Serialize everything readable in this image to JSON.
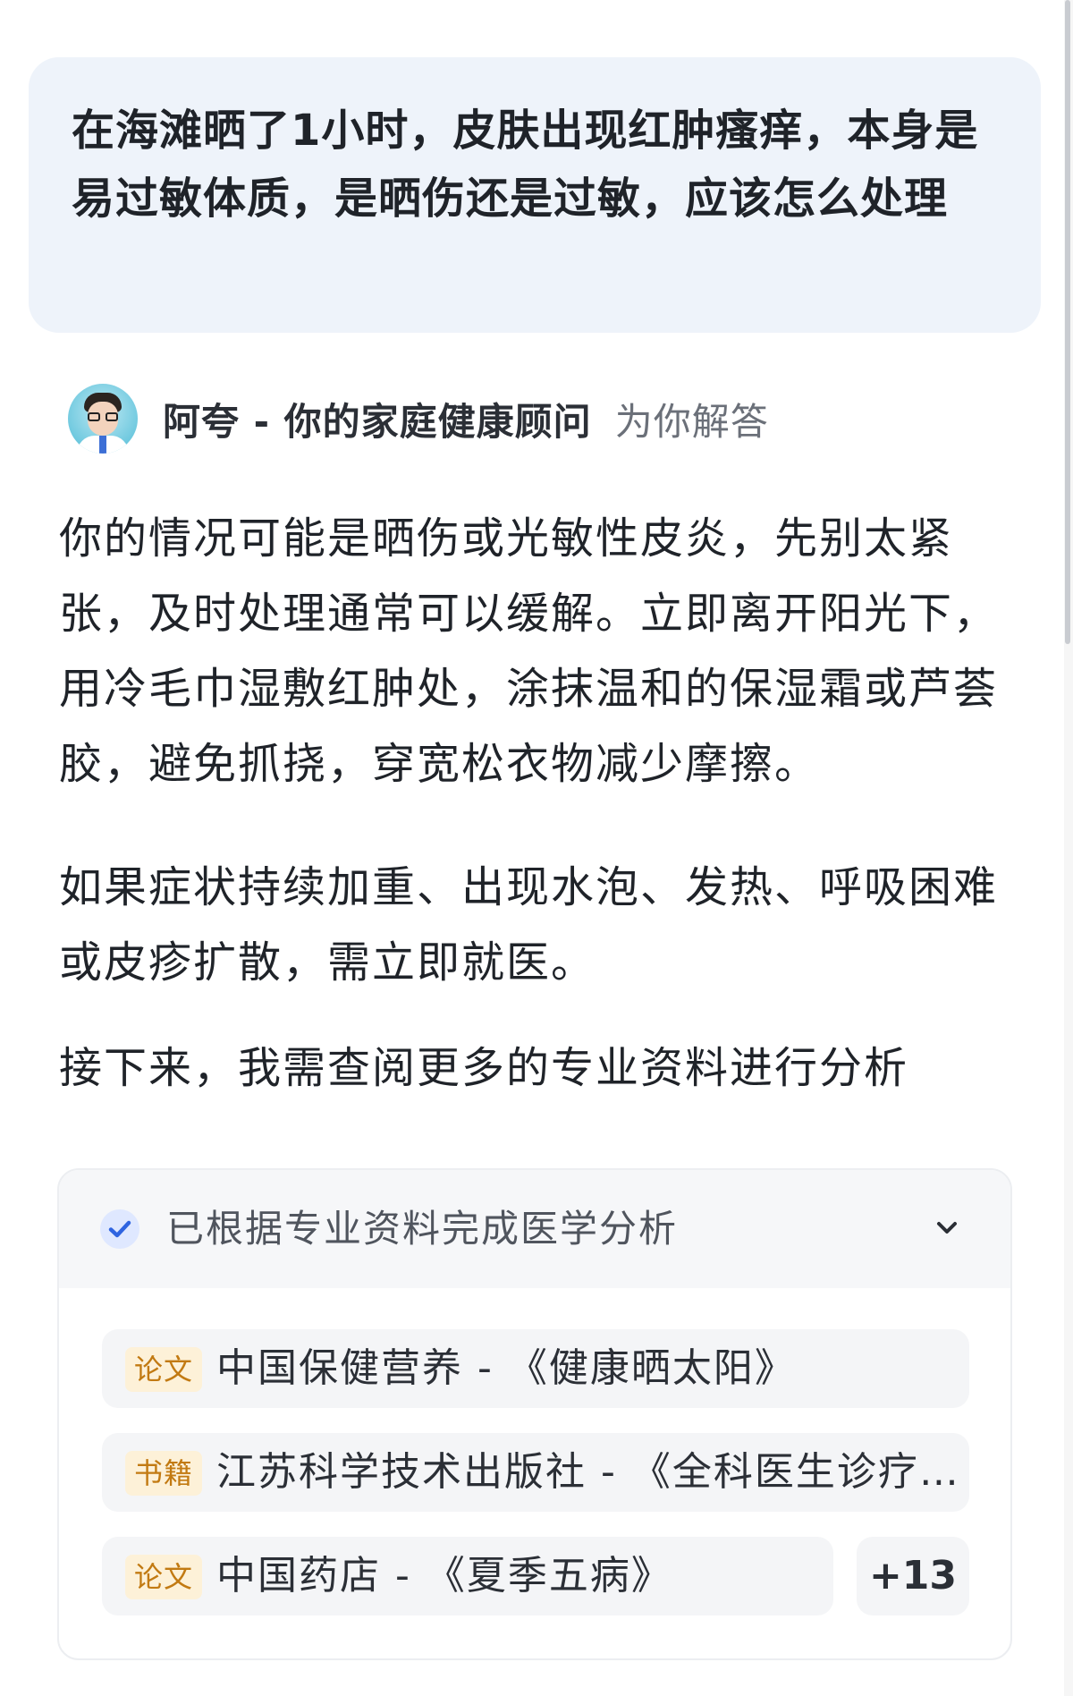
{
  "question": {
    "text": "在海滩晒了1小时，皮肤出现红肿瘙痒，本身是易过敏体质，是晒伤还是过敏，应该怎么处理"
  },
  "assistant": {
    "name": "阿夸 - 你的家庭健康顾问",
    "suffix": "为你解答",
    "avatar_icon": "doctor-avatar-icon"
  },
  "answer": {
    "paragraphs": [
      "你的情况可能是晒伤或光敏性皮炎，先别太紧张，及时处理通常可以缓解。立即离开阳光下，用冷毛巾湿敷红肿处，涂抹温和的保湿霜或芦荟胶，避免抓挠，穿宽松衣物减少摩擦。",
      "如果症状持续加重、出现水泡、发热、呼吸困难或皮疹扩散，需立即就医。",
      "接下来，我需查阅更多的专业资料进行分析"
    ]
  },
  "sources": {
    "title": "已根据专业资料完成医学分析",
    "check_icon": "check-circle-icon",
    "expand_icon": "chevron-down-icon",
    "items": [
      {
        "tag": "论文",
        "text": "中国保健营养 - 《健康晒太阳》"
      },
      {
        "tag": "书籍",
        "text": "江苏科学技术出版社 - 《全科医生诊疗..."
      },
      {
        "tag": "论文",
        "text": "中国药店 - 《夏季五病》"
      }
    ],
    "more_count": "+13"
  },
  "colors": {
    "question_bg": "#eef3fa",
    "tag_bg": "#fdf1d8",
    "tag_text": "#c27a12",
    "check_bg": "#dfe8ff",
    "check_fg": "#2f64e0",
    "card_header_bg": "#f6f7f9",
    "row_bg": "#f4f5f7"
  }
}
